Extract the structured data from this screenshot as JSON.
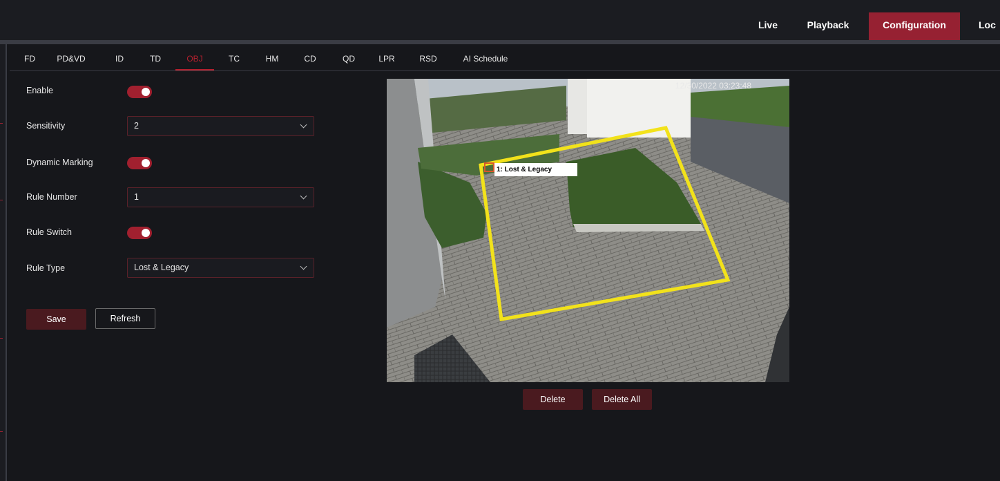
{
  "top_nav": {
    "items": [
      {
        "label": "Live"
      },
      {
        "label": "Playback"
      },
      {
        "label": "Configuration",
        "active": true
      },
      {
        "label": "Loc"
      }
    ]
  },
  "sub_tabs": {
    "items": [
      {
        "label": "FD"
      },
      {
        "label": "PD&VD"
      },
      {
        "label": "ID"
      },
      {
        "label": "TD"
      },
      {
        "label": "OBJ",
        "active": true
      },
      {
        "label": "TC"
      },
      {
        "label": "HM"
      },
      {
        "label": "CD"
      },
      {
        "label": "QD"
      },
      {
        "label": "LPR"
      },
      {
        "label": "RSD"
      },
      {
        "label": "AI Schedule"
      }
    ]
  },
  "form": {
    "enable_label": "Enable",
    "enable_value": true,
    "sensitivity_label": "Sensitivity",
    "sensitivity_value": "2",
    "dynamic_marking_label": "Dynamic Marking",
    "dynamic_marking_value": true,
    "rule_number_label": "Rule Number",
    "rule_number_value": "1",
    "rule_switch_label": "Rule Switch",
    "rule_switch_value": true,
    "rule_type_label": "Rule Type",
    "rule_type_value": "Lost & Legacy"
  },
  "buttons": {
    "save": "Save",
    "refresh": "Refresh",
    "delete": "Delete",
    "delete_all": "Delete All"
  },
  "video": {
    "timestamp": "12/30/2022 03:23:48",
    "rule_label": "1: Lost & Legacy",
    "region_color": "#f2e21b"
  },
  "colors": {
    "accent": "#962132",
    "toggle_on": "#a1202f",
    "background": "#16171b"
  }
}
